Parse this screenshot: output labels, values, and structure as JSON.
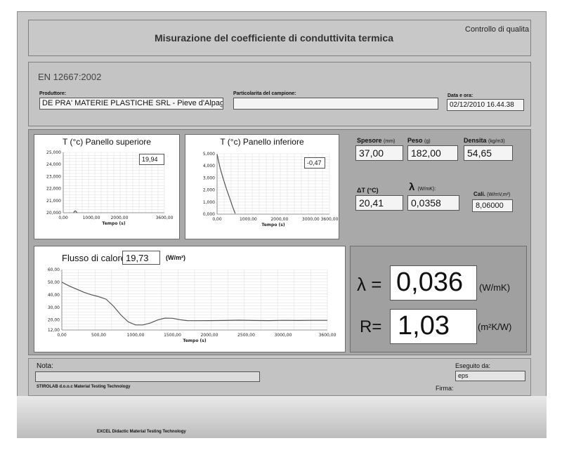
{
  "header": {
    "title": "Misurazione del coefficiente di conduttivita termica",
    "top_right": "Controllo di qualita"
  },
  "info": {
    "standard": "EN 12667:2002",
    "producer_label": "Produttore:",
    "producer_value": "DE PRA' MATERIE PLASTICHE SRL - Pieve d'Alpago",
    "sample_label": "Particolarita del campione:",
    "sample_value": "",
    "date_label": "Data e ora:",
    "date_value": "02/12/2010 16.44.38"
  },
  "measures": {
    "spessore_label": "Spesore",
    "spessore_unit": "(mm)",
    "spessore_value": "37,00",
    "peso_label": "Peso",
    "peso_unit": "(g)",
    "peso_value": "182,00",
    "densita_label": "Densita",
    "densita_unit": "(kg/m3)",
    "densita_value": "54,65",
    "dt_label": "ΔT (°C)",
    "dt_value": "20,41",
    "lambda_symbol": "λ",
    "lambda_unit": "(W/mK):",
    "lambda_value": "0,0358",
    "cal_label": "Cali.",
    "cal_unit": "(W/mV,m²)",
    "cal_value": "8,06000"
  },
  "result": {
    "lambda_symbol": "λ =",
    "lambda_value": "0,036",
    "lambda_unit": "(W/mK)",
    "r_symbol": "R=",
    "r_value": "1,03",
    "r_unit": "(m²K/W)"
  },
  "footer": {
    "nota_label": "Nota:",
    "nota_value": "",
    "company_small": "STIROLAB d.o.o.c Material Testing Technology",
    "eseguito_label": "Eseguito da:",
    "eseguito_value": "eps",
    "firma_label": "Firma:",
    "bottom_caption": "EXCEL Didactic Material Testing Technology"
  },
  "charts": {
    "flux_label": "Flusso di calore",
    "flux_value": "19,73",
    "flux_unit": "(W/m²)"
  },
  "chart_data": [
    {
      "type": "line",
      "title": "T (°c) Panello superiore",
      "xlabel": "Tempo (s)",
      "ylabel": "",
      "readout": "19,94",
      "xlim": [
        0,
        3600
      ],
      "ylim": [
        20,
        25
      ],
      "xticks": [
        "0,00",
        "1000,00",
        "2000,00",
        "3600,00"
      ],
      "xtick_values": [
        0,
        1000,
        2000,
        3600
      ],
      "yticks": [
        "20,000",
        "21,000",
        "22,000",
        "23,000",
        "24,000",
        "25,000"
      ],
      "ytick_values": [
        20,
        21,
        22,
        23,
        24,
        25
      ],
      "series": [
        {
          "x": [
            370,
            400,
            430,
            460,
            490
          ],
          "y": [
            20.0,
            20.12,
            20.15,
            20.1,
            20.0
          ]
        }
      ]
    },
    {
      "type": "line",
      "title": "T (°c) Panello inferiore",
      "xlabel": "Tempo (s)",
      "ylabel": "",
      "readout": "-0,47",
      "xlim": [
        0,
        3600
      ],
      "ylim": [
        0,
        5
      ],
      "xticks": [
        "0,00",
        "1000,00",
        "2000,00",
        "3000,00",
        "3600,00"
      ],
      "xtick_values": [
        0,
        1000,
        2000,
        3000,
        3600
      ],
      "yticks": [
        "0,000",
        "1,000",
        "2,000",
        "3,000",
        "4,000",
        "5,000"
      ],
      "ytick_values": [
        0,
        1,
        2,
        3,
        4,
        5
      ],
      "series": [
        {
          "x": [
            0,
            100,
            200,
            300,
            400,
            500,
            580
          ],
          "y": [
            4.95,
            3.8,
            2.9,
            2.1,
            1.35,
            0.6,
            0.05
          ]
        }
      ]
    },
    {
      "type": "line",
      "title": "",
      "xlabel": "Tempo (s)",
      "ylabel": "",
      "xlim": [
        0,
        3600
      ],
      "ylim": [
        12,
        60
      ],
      "xticks": [
        "0,00",
        "500,00",
        "1000,00",
        "1500,00",
        "2000,00",
        "2500,00",
        "3000,00",
        "3600,00"
      ],
      "xtick_values": [
        0,
        500,
        1000,
        1500,
        2000,
        2500,
        3000,
        3600
      ],
      "yticks": [
        "12,00",
        "20,00",
        "30,00",
        "40,00",
        "50,00",
        "60,00"
      ],
      "ytick_values": [
        12,
        20,
        30,
        40,
        50,
        60
      ],
      "series": [
        {
          "x": [
            0,
            100,
            200,
            300,
            400,
            500,
            600,
            700,
            800,
            900,
            1000,
            1100,
            1200,
            1300,
            1400,
            1500,
            1600,
            1700,
            1800,
            2000,
            2200,
            2400,
            2600,
            2800,
            3000,
            3200,
            3400,
            3600
          ],
          "y": [
            50,
            47,
            44.5,
            42,
            40,
            38.5,
            36.5,
            31,
            24,
            18.5,
            16,
            16,
            17.5,
            20,
            21.5,
            21.3,
            20.2,
            19.5,
            19.4,
            19.5,
            19.6,
            19.8,
            19.6,
            19.5,
            19.7,
            19.6,
            19.7,
            19.7
          ]
        }
      ]
    }
  ]
}
